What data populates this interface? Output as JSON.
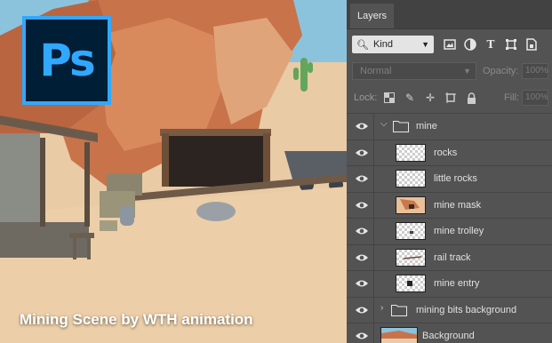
{
  "logo": {
    "text": "Ps"
  },
  "caption": "Mining Scene by WTH animation",
  "panel": {
    "tab": "Layers",
    "filter": {
      "kind_label": "Kind",
      "icons": [
        "image-filter-icon",
        "adjustment-filter-icon",
        "type-filter-icon",
        "shape-filter-icon",
        "smart-object-filter-icon"
      ]
    },
    "blend_mode": "Normal",
    "opacity_label": "Opacity:",
    "opacity_value": "100%",
    "lock_label": "Lock:",
    "fill_label": "Fill:",
    "fill_value": "100%",
    "layers": [
      {
        "name": "mine",
        "type": "group",
        "expanded": true
      },
      {
        "name": "rocks",
        "type": "layer"
      },
      {
        "name": "little rocks",
        "type": "layer"
      },
      {
        "name": "mine mask",
        "type": "layer"
      },
      {
        "name": "mine trolley",
        "type": "layer"
      },
      {
        "name": "rail track",
        "type": "layer"
      },
      {
        "name": "mine entry",
        "type": "layer"
      },
      {
        "name": "mining bits background",
        "type": "group",
        "expanded": false
      },
      {
        "name": "Background",
        "type": "background"
      }
    ]
  },
  "colors": {
    "ps_blue": "#31a8ff",
    "ps_dark": "#001e36",
    "panel_bg": "#535353"
  }
}
